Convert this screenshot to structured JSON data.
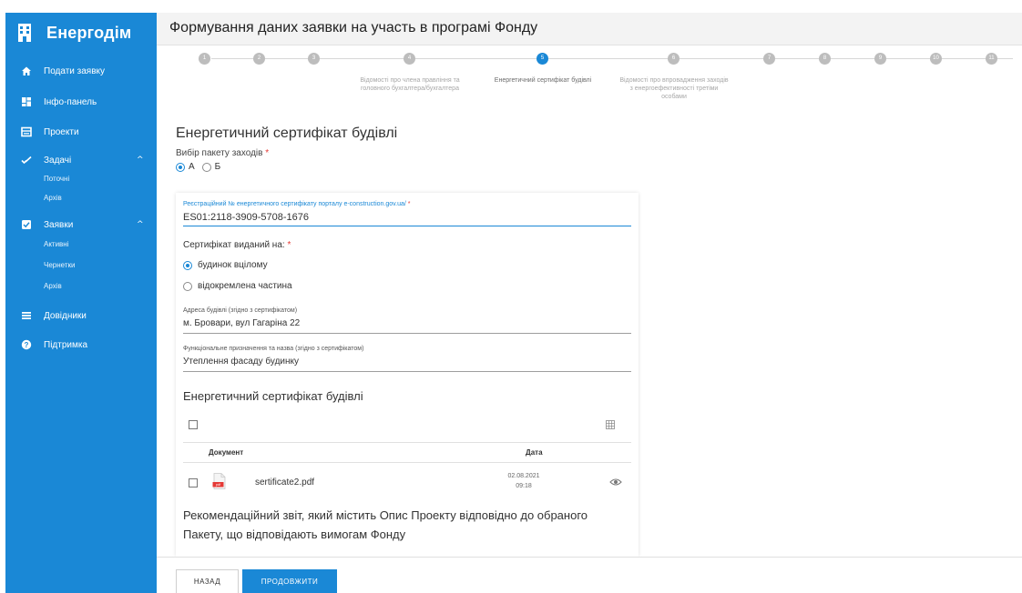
{
  "brand": {
    "name": "Енергодім"
  },
  "sidebar": {
    "items": [
      {
        "label": "Подати заявку",
        "icon": "home-icon"
      },
      {
        "label": "Інфо-панель",
        "icon": "dashboard-icon"
      },
      {
        "label": "Проекти",
        "icon": "projects-icon"
      },
      {
        "label": "Задачі",
        "icon": "check-icon",
        "expanded": true,
        "children": [
          "Поточні",
          "Архів"
        ]
      },
      {
        "label": "Заявки",
        "icon": "checkbox-icon",
        "expanded": true,
        "children": [
          "Активні",
          "Чернетки",
          "Архів"
        ]
      },
      {
        "label": "Довідники",
        "icon": "menu-icon"
      },
      {
        "label": "Підтримка",
        "icon": "help-icon"
      }
    ],
    "chevron": "^"
  },
  "header": {
    "title": "Формування даних заявки на участь в програмі Фонду"
  },
  "stepper": {
    "steps": [
      {
        "num": "1",
        "text": ""
      },
      {
        "num": "2",
        "text": ""
      },
      {
        "num": "3",
        "text": ""
      },
      {
        "num": "4",
        "text": "Відомості про члена правління та головного бухгалтера/бухгалтера"
      },
      {
        "num": "5",
        "text": "Енергетичний сертифікат будівлі",
        "active": true
      },
      {
        "num": "6",
        "text": "Відомості про впровадження заходів з енергоефективності третіми особами"
      },
      {
        "num": "7",
        "text": ""
      },
      {
        "num": "8",
        "text": ""
      },
      {
        "num": "9",
        "text": ""
      },
      {
        "num": "10",
        "text": ""
      },
      {
        "num": "11",
        "text": ""
      }
    ],
    "active_color": "#1a88d6"
  },
  "form": {
    "title": "Енергетичний сертифікат будівлі",
    "package_label": "Вибір пакету заходів",
    "package_options": [
      "А",
      "Б"
    ],
    "package_selected": "А",
    "reg_label": "Реєстраційний № енергетичного сертифікату порталу e-construction.gov.ua/",
    "reg_value": "ES01:2118-3909-5708-1676",
    "issued_label": "Сертифікат виданий на:",
    "issued_options": [
      "будинок вцілому",
      "відокремлена частина"
    ],
    "issued_selected": "будинок вцілому",
    "address_label": "Адреса будівлі (згідно з сертифікатом)",
    "address_value": "м. Бровари, вул Гагаріна 22",
    "purpose_label": "Функціональне призначення та назва (згідно з сертифікатом)",
    "purpose_value": "Утеплення фасаду будинку",
    "required_mark": "*"
  },
  "documents": {
    "title": "Енергетичний сертифікат будівлі",
    "columns": {
      "doc": "Документ",
      "date": "Дата"
    },
    "rows": [
      {
        "name": "sertificate2.pdf",
        "date": "02.08.2021",
        "time": "09:18"
      }
    ]
  },
  "recommendation": {
    "text": "Рекомендаційний звіт, який містить Опис Проекту відповідно до обраного Пакету, що відповідають вимогам Фонду"
  },
  "footer": {
    "back_label": "НАЗАД",
    "next_label": "ПРОДОВЖИТИ"
  },
  "colors": {
    "primary": "#1a88d6",
    "required": "#e53935",
    "pdf": "#e53935"
  }
}
